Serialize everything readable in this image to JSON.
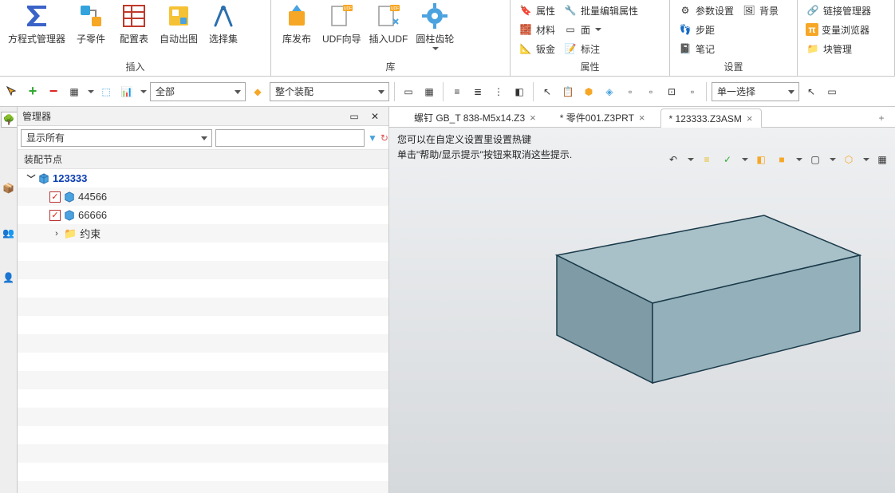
{
  "ribbon": {
    "groups": [
      {
        "title": "插入",
        "items": [
          {
            "label": "方程式管理器"
          },
          {
            "label": "子零件"
          },
          {
            "label": "配置表"
          },
          {
            "label": "自动出图"
          },
          {
            "label": "选择集"
          }
        ]
      },
      {
        "title": "库",
        "items": [
          {
            "label": "库发布"
          },
          {
            "label": "UDF向导"
          },
          {
            "label": "插入UDF"
          },
          {
            "label": "圆柱齿轮"
          }
        ]
      },
      {
        "title": "属性",
        "small": [
          {
            "label": "属性"
          },
          {
            "label": "材料"
          },
          {
            "label": "钣金"
          },
          {
            "label": "批量编辑属性"
          },
          {
            "label": "面"
          },
          {
            "label": "标注"
          }
        ]
      },
      {
        "title": "设置",
        "small": [
          {
            "label": "参数设置"
          },
          {
            "label": "步距"
          },
          {
            "label": "笔记"
          },
          {
            "label": "背景"
          }
        ]
      },
      {
        "title": "",
        "small": [
          {
            "label": "链接管理器"
          },
          {
            "label": "变量浏览器"
          },
          {
            "label": "块管理"
          }
        ]
      }
    ]
  },
  "quickbar": {
    "filter1": "全部",
    "filter2": "整个装配",
    "rightSelect": "单一选择"
  },
  "panel": {
    "title": "管理器",
    "filter": "显示所有",
    "sub_header": "装配节点",
    "root": "123333",
    "child1": "44566",
    "child2": "66666",
    "constraints": "约束"
  },
  "tabs": {
    "t1": "螺钉 GB_T 838-M5x14.Z3",
    "t2": "* 零件001.Z3PRT",
    "t3": "* 123333.Z3ASM"
  },
  "hint": {
    "line1": "您可以在自定义设置里设置热键",
    "line2": "单击\"帮助/显示提示\"按钮来取消这些提示."
  }
}
